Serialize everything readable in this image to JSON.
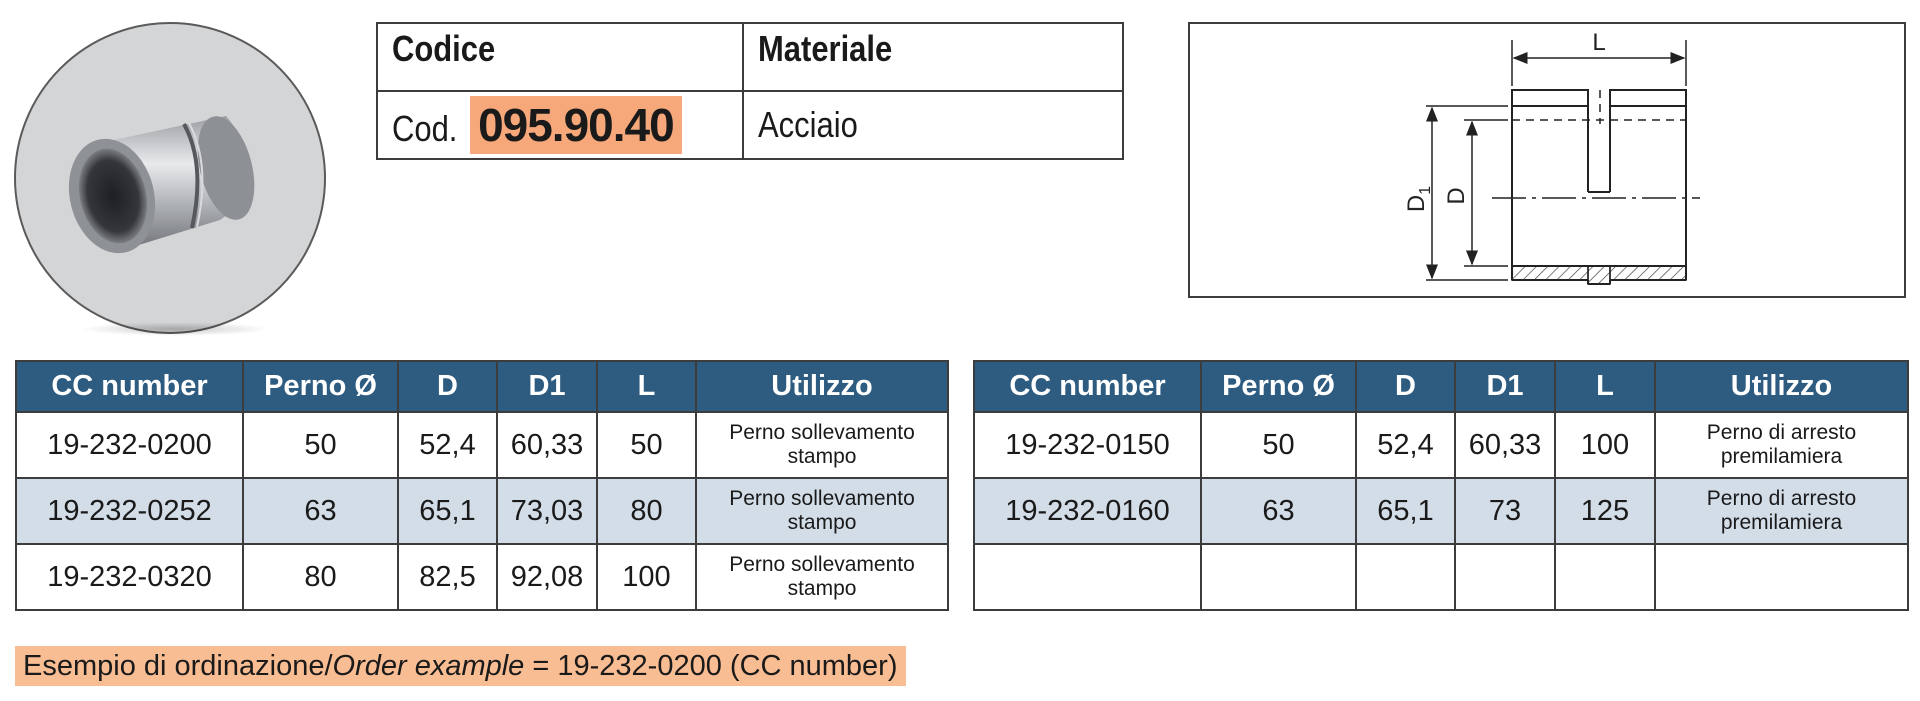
{
  "code_table": {
    "code_header": "Codice",
    "material_header": "Materiale",
    "code_prefix": "Cod.",
    "code_value": "095.90.40",
    "material_value": "Acciaio"
  },
  "drawing": {
    "dim_L": "L",
    "dim_D1": "D",
    "dim_D1_sub": "1",
    "dim_D": "D"
  },
  "tables": {
    "headers": [
      "CC number",
      "Perno Ø",
      "D",
      "D1",
      "L",
      "Utilizzo"
    ],
    "left_rows": [
      [
        "19-232-0200",
        "50",
        "52,4",
        "60,33",
        "50",
        "Perno sollevamento",
        "stampo"
      ],
      [
        "19-232-0252",
        "63",
        "65,1",
        "73,03",
        "80",
        "Perno sollevamento",
        "stampo"
      ],
      [
        "19-232-0320",
        "80",
        "82,5",
        "92,08",
        "100",
        "Perno sollevamento",
        "stampo"
      ]
    ],
    "right_rows": [
      [
        "19-232-0150",
        "50",
        "52,4",
        "60,33",
        "100",
        "Perno di arresto",
        "premilamiera"
      ],
      [
        "19-232-0160",
        "63",
        "65,1",
        "73",
        "125",
        "Perno di arresto",
        "premilamiera"
      ]
    ]
  },
  "order_example": {
    "label_it": "Esempio di ordinazione/",
    "label_en": "Order example",
    "value": " = 19-232-0200 (CC number)"
  },
  "colors": {
    "header_blue": "#2e5b80",
    "row_alt": "#d3dde8",
    "highlight_orange": "#f7a87a",
    "order_bg": "#f9bd93"
  }
}
